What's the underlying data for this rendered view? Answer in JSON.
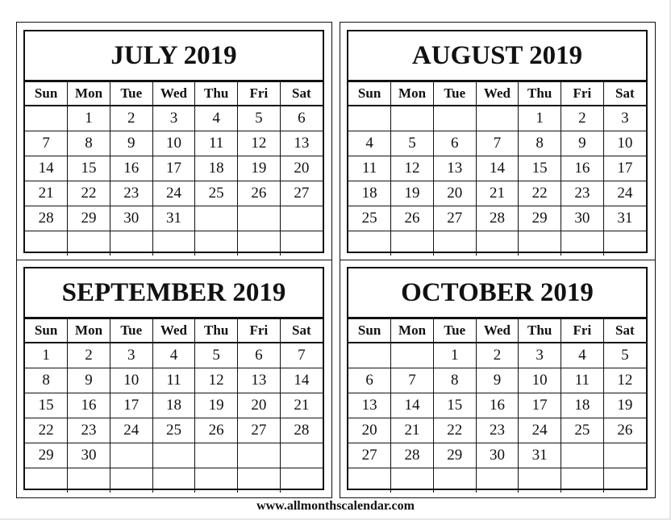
{
  "weekdays": [
    "Sun",
    "Mon",
    "Tue",
    "Wed",
    "Thu",
    "Fri",
    "Sat"
  ],
  "months": [
    {
      "title": "JULY 2019",
      "rows": [
        [
          "",
          "1",
          "2",
          "3",
          "4",
          "5",
          "6"
        ],
        [
          "7",
          "8",
          "9",
          "10",
          "11",
          "12",
          "13"
        ],
        [
          "14",
          "15",
          "16",
          "17",
          "18",
          "19",
          "20"
        ],
        [
          "21",
          "22",
          "23",
          "24",
          "25",
          "26",
          "27"
        ],
        [
          "28",
          "29",
          "30",
          "31",
          "",
          "",
          ""
        ],
        [
          "",
          "",
          "",
          "",
          "",
          "",
          ""
        ]
      ]
    },
    {
      "title": "AUGUST 2019",
      "rows": [
        [
          "",
          "",
          "",
          "",
          "1",
          "2",
          "3"
        ],
        [
          "4",
          "5",
          "6",
          "7",
          "8",
          "9",
          "10"
        ],
        [
          "11",
          "12",
          "13",
          "14",
          "15",
          "16",
          "17"
        ],
        [
          "18",
          "19",
          "20",
          "21",
          "22",
          "23",
          "24"
        ],
        [
          "25",
          "26",
          "27",
          "28",
          "29",
          "30",
          "31"
        ],
        [
          "",
          "",
          "",
          "",
          "",
          "",
          ""
        ]
      ]
    },
    {
      "title": "SEPTEMBER 2019",
      "rows": [
        [
          "1",
          "2",
          "3",
          "4",
          "5",
          "6",
          "7"
        ],
        [
          "8",
          "9",
          "10",
          "11",
          "12",
          "13",
          "14"
        ],
        [
          "15",
          "16",
          "17",
          "18",
          "19",
          "20",
          "21"
        ],
        [
          "22",
          "23",
          "24",
          "25",
          "26",
          "27",
          "28"
        ],
        [
          "29",
          "30",
          "",
          "",
          "",
          "",
          ""
        ],
        [
          "",
          "",
          "",
          "",
          "",
          "",
          ""
        ]
      ]
    },
    {
      "title": "OCTOBER 2019",
      "rows": [
        [
          "",
          "",
          "1",
          "2",
          "3",
          "4",
          "5"
        ],
        [
          "6",
          "7",
          "8",
          "9",
          "10",
          "11",
          "12"
        ],
        [
          "13",
          "14",
          "15",
          "16",
          "17",
          "18",
          "19"
        ],
        [
          "20",
          "21",
          "22",
          "23",
          "24",
          "25",
          "26"
        ],
        [
          "27",
          "28",
          "29",
          "30",
          "31",
          "",
          ""
        ],
        [
          "",
          "",
          "",
          "",
          "",
          "",
          ""
        ]
      ]
    }
  ],
  "footer": "www.allmonthscalendar.com"
}
